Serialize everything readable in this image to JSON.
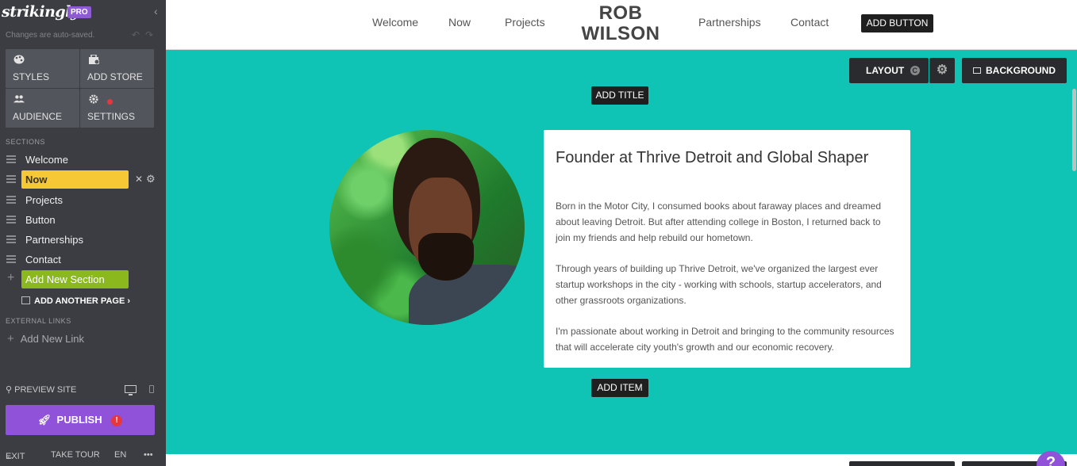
{
  "sidebar": {
    "brand": "strikingly",
    "pro_badge": "PRO",
    "autosave": "Changes are auto-saved.",
    "tiles": [
      {
        "label": "STYLES",
        "icon": "palette-icon"
      },
      {
        "label": "ADD STORE",
        "icon": "store-icon"
      },
      {
        "label": "AUDIENCE",
        "icon": "people-icon"
      },
      {
        "label": "SETTINGS",
        "icon": "gear-icon"
      }
    ],
    "sections_heading": "SECTIONS",
    "sections": [
      {
        "label": "Welcome",
        "active": false
      },
      {
        "label": "Now",
        "active": true
      },
      {
        "label": "Projects",
        "active": false
      },
      {
        "label": "Button",
        "active": false
      },
      {
        "label": "Partnerships",
        "active": false
      },
      {
        "label": "Contact",
        "active": false
      }
    ],
    "add_section": "Add New Section",
    "add_page": "ADD ANOTHER PAGE",
    "external_heading": "EXTERNAL LINKS",
    "add_link": "Add New Link",
    "preview": "PREVIEW SITE",
    "publish": "PUBLISH",
    "publish_warning": "!",
    "footer": {
      "exit": "EXIT",
      "tour": "TAKE TOUR",
      "lang": "EN",
      "more": "•••"
    }
  },
  "site": {
    "nav": [
      "Welcome",
      "Now",
      "Projects",
      "Partnerships",
      "Contact"
    ],
    "logo_line1": "ROB",
    "logo_line2": "WILSON",
    "add_button": "ADD BUTTON"
  },
  "section": {
    "layout_label": "LAYOUT",
    "layout_badge": "C",
    "background_label": "BACKGROUND",
    "add_title": "ADD TITLE",
    "add_item": "ADD ITEM",
    "bg_color": "#0fc4b5",
    "card_title": "Founder at Thrive Detroit and Global Shaper",
    "paragraphs": [
      "Born in the Motor City, I consumed books about faraway places and dreamed about leaving Detroit. But after attending college in Boston, I returned back to join my friends and help rebuild our hometown.",
      "Through years of building up Thrive Detroit, we've organized the largest ever startup workshops in the city - working with schools, startup accelerators, and other grassroots organizations.",
      "I'm passionate about working in Detroit and bringing to the community resources that will accelerate city youth's growth and our economic recovery."
    ]
  },
  "help": "?"
}
